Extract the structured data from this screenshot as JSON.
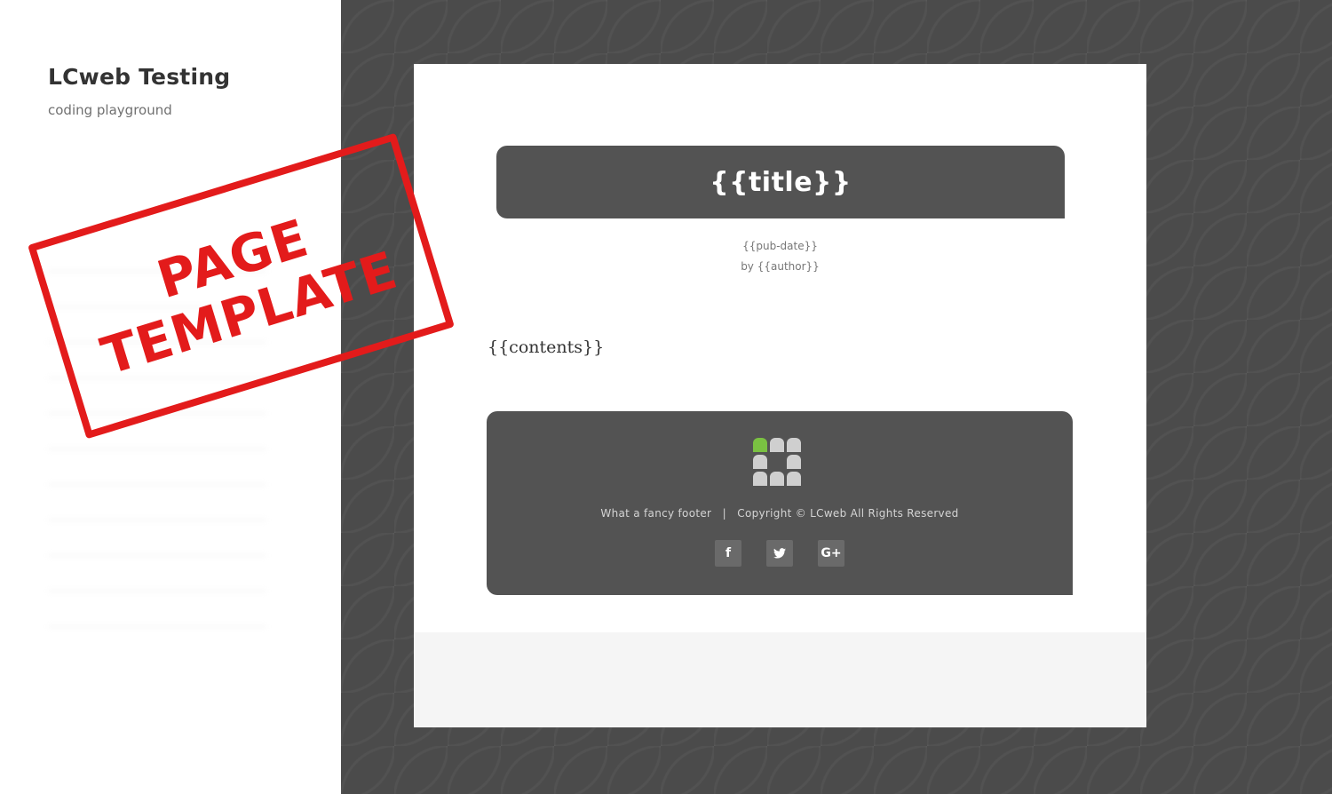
{
  "site": {
    "title": "LCweb Testing",
    "description": "coding playground"
  },
  "stamp": {
    "line1": "PAGE",
    "line2": "TEMPLATE",
    "color": "#e31b1b"
  },
  "template": {
    "title": "{{title}}",
    "pub_date": "{{pub-date}}",
    "author": "by {{author}}",
    "contents": "{{contents}}",
    "footer_text": "What a fancy footer   |   Copyright © LCweb All Rights Reserved",
    "socials": [
      {
        "icon": "facebook-icon",
        "glyph": "f"
      },
      {
        "icon": "twitter-icon",
        "glyph": "🐦"
      },
      {
        "icon": "google-plus-icon",
        "glyph": "G+"
      }
    ]
  },
  "colors": {
    "backdrop": "#4b4b4b",
    "panel": "#535353",
    "logo_accent": "#7ac142"
  }
}
